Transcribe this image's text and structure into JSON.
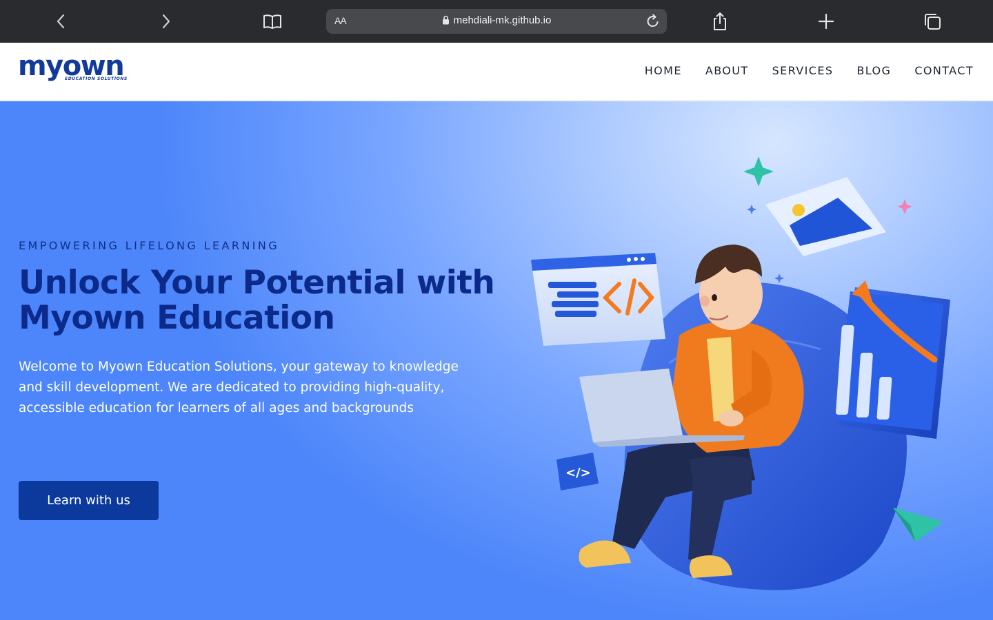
{
  "browser": {
    "text_size_label": "AA",
    "url": "mehdiali-mk.github.io"
  },
  "site": {
    "logo_word": "myown",
    "logo_sub": "EDUCATION SOLUTIONS",
    "nav": [
      "HOME",
      "ABOUT",
      "SERVICES",
      "BLOG",
      "CONTACT"
    ]
  },
  "hero": {
    "eyebrow": "EMPOWERING LIFELONG LEARNING",
    "headline": "Unlock Your Potential with Myown Education",
    "intro": "Welcome to Myown Education Solutions, your gateway to knowledge and skill development. We are dedicated to providing high-quality, accessible education for learners of all ages and backgrounds",
    "cta_label": "Learn with us",
    "code_icon_label": "</>"
  },
  "colors": {
    "brand_navy": "#0b2a8a",
    "button": "#0b3a9c",
    "hero_gradient_light": "#d6e6ff",
    "hero_gradient_dark": "#4d86fa",
    "chrome_bg": "#2a2b2e"
  },
  "icons": [
    "back-icon",
    "forward-icon",
    "bookmarks-icon",
    "lock-icon",
    "reload-icon",
    "share-icon",
    "new-tab-icon",
    "tabs-icon"
  ]
}
